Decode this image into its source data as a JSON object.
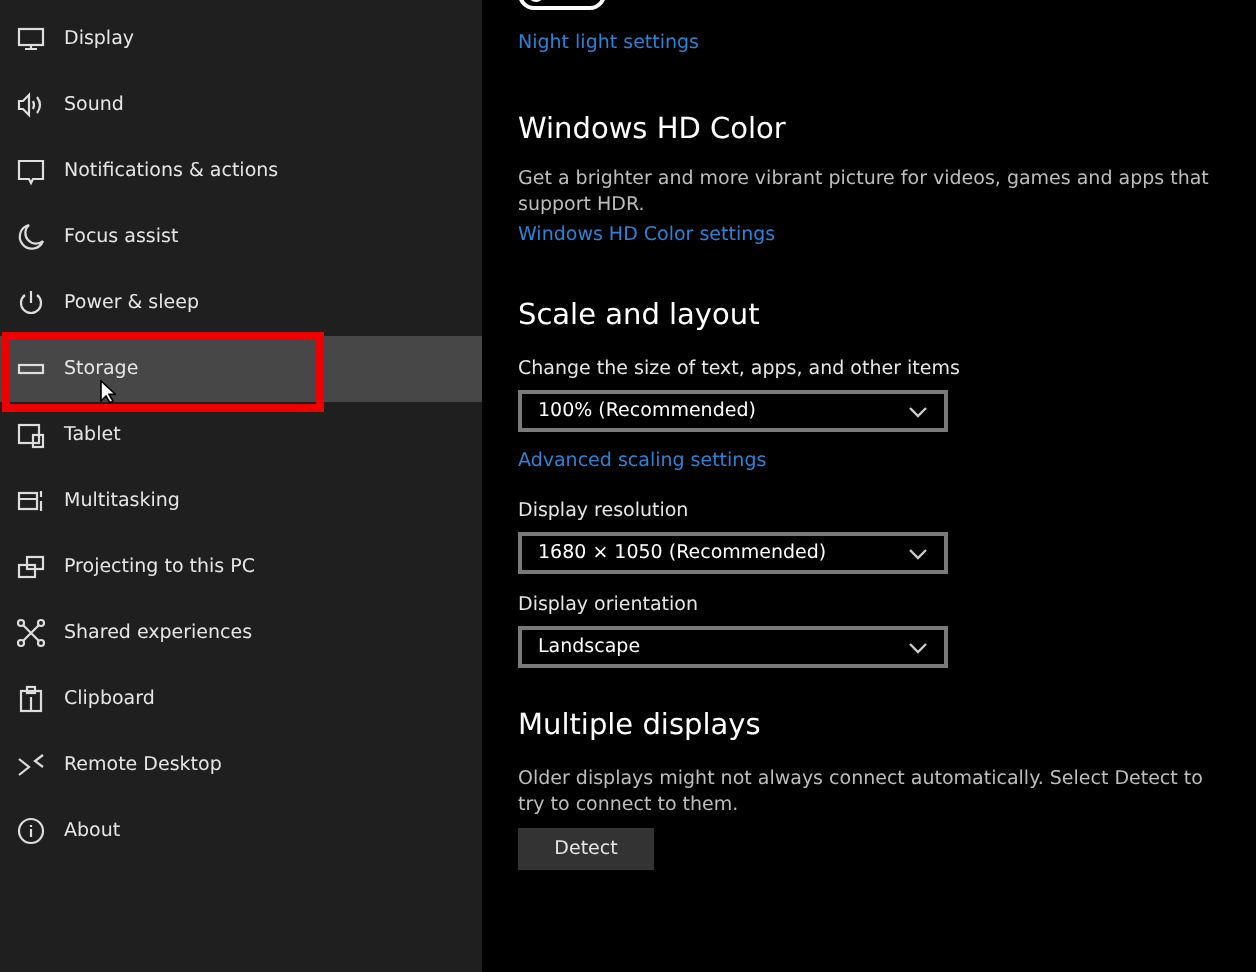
{
  "sidebar": {
    "items": [
      {
        "label": "Display",
        "kind": "display",
        "highlighted": false,
        "annotated": false
      },
      {
        "label": "Sound",
        "kind": "sound",
        "highlighted": false,
        "annotated": false
      },
      {
        "label": "Notifications & actions",
        "kind": "notifications",
        "highlighted": false,
        "annotated": false
      },
      {
        "label": "Focus assist",
        "kind": "moon",
        "highlighted": false,
        "annotated": false
      },
      {
        "label": "Power & sleep",
        "kind": "power",
        "highlighted": false,
        "annotated": false
      },
      {
        "label": "Storage",
        "kind": "storage",
        "highlighted": true,
        "annotated": true
      },
      {
        "label": "Tablet",
        "kind": "tablet",
        "highlighted": false,
        "annotated": false
      },
      {
        "label": "Multitasking",
        "kind": "multitasking",
        "highlighted": false,
        "annotated": false
      },
      {
        "label": "Projecting to this PC",
        "kind": "projecting",
        "highlighted": false,
        "annotated": false
      },
      {
        "label": "Shared experiences",
        "kind": "shared",
        "highlighted": false,
        "annotated": false
      },
      {
        "label": "Clipboard",
        "kind": "clipboard",
        "highlighted": false,
        "annotated": false
      },
      {
        "label": "Remote Desktop",
        "kind": "remote",
        "highlighted": false,
        "annotated": false
      },
      {
        "label": "About",
        "kind": "about",
        "highlighted": false,
        "annotated": false
      }
    ]
  },
  "night_light": {
    "on": false,
    "link": "Night light settings"
  },
  "hd_color": {
    "title": "Windows HD Color",
    "description": "Get a brighter and more vibrant picture for videos, games and apps that support HDR.",
    "link": "Windows HD Color settings"
  },
  "scale_layout": {
    "title": "Scale and layout",
    "scale_label": "Change the size of text, apps, and other items",
    "scale_value": "100% (Recommended)",
    "advanced_link": "Advanced scaling settings",
    "resolution_label": "Display resolution",
    "resolution_value": "1680 × 1050 (Recommended)",
    "orientation_label": "Display orientation",
    "orientation_value": "Landscape"
  },
  "multiple_displays": {
    "title": "Multiple displays",
    "description": "Older displays might not always connect automatically. Select Detect to try to connect to them.",
    "button": "Detect"
  }
}
